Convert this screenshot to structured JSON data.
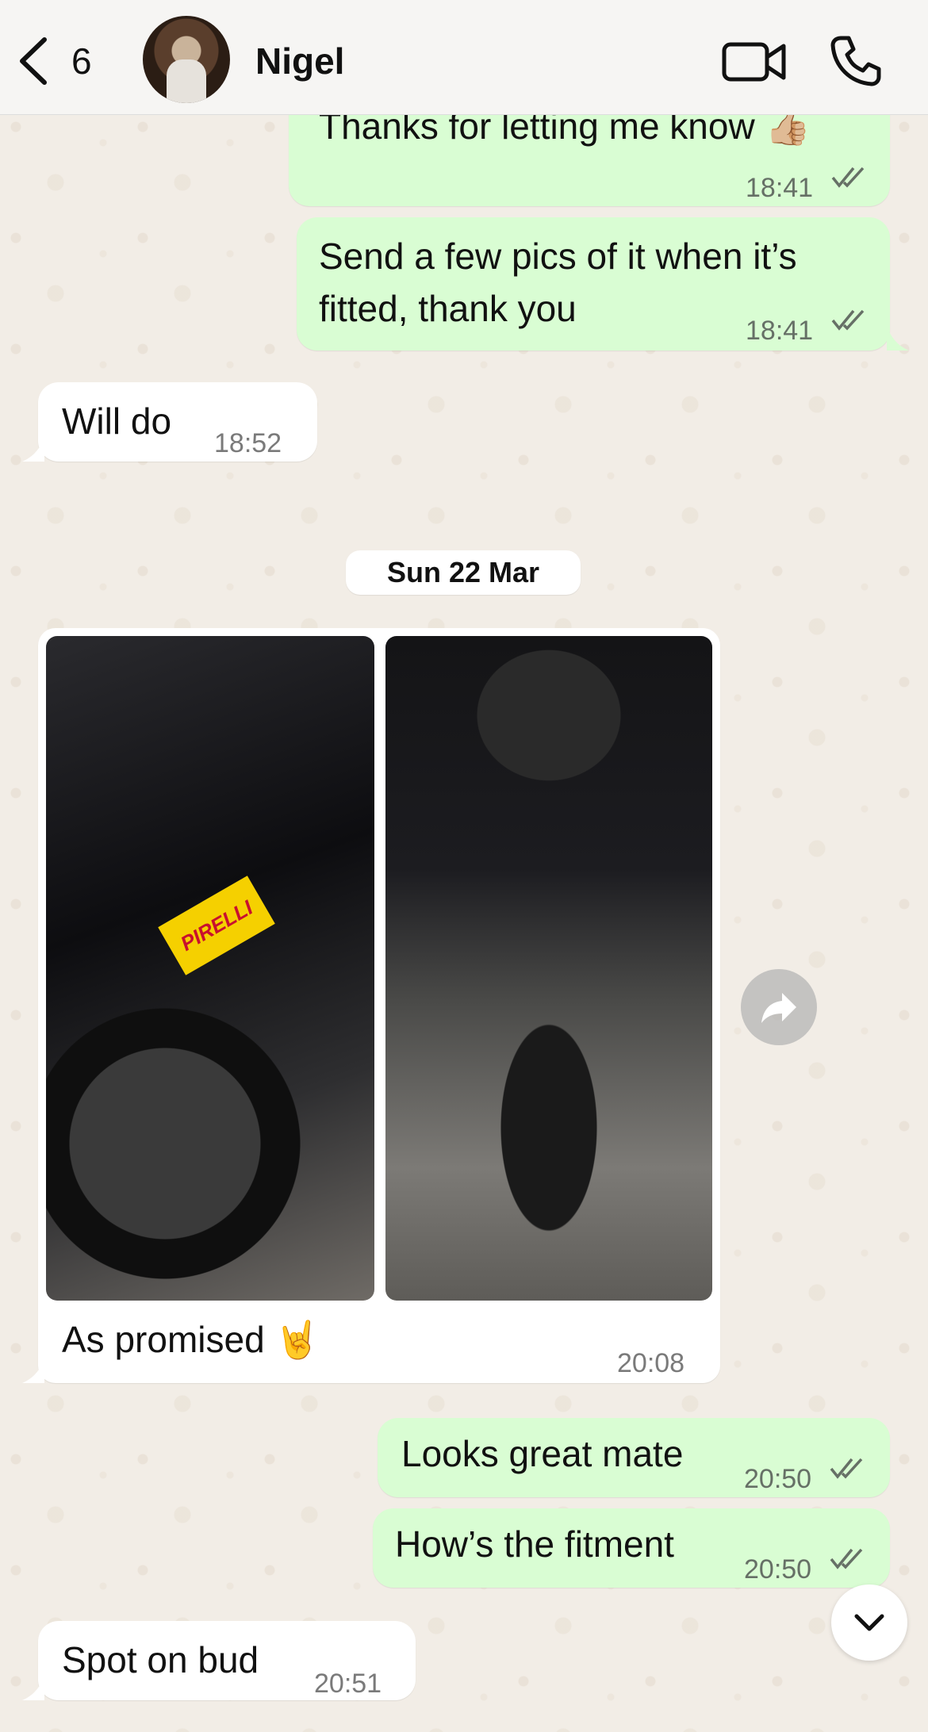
{
  "header": {
    "back_count": "6",
    "contact_name": "Nigel"
  },
  "messages": [
    {
      "text": "Thanks for letting me know 👍🏼",
      "time": "18:41",
      "direction": "out"
    },
    {
      "text_line1": "Send a few pics of it when it’s",
      "text_line2": "fitted, thank you",
      "time": "18:41",
      "direction": "out"
    },
    {
      "text": "Will do",
      "time": "18:52",
      "direction": "in"
    },
    {
      "caption": "As promised 🤘",
      "time": "20:08",
      "direction": "in"
    },
    {
      "text": "Looks great mate",
      "time": "20:50",
      "direction": "out"
    },
    {
      "text": "How’s the fitment",
      "time": "20:50",
      "direction": "out"
    },
    {
      "text": "Spot on bud",
      "time": "20:51",
      "direction": "in"
    }
  ],
  "date_separator": "Sun 22 Mar",
  "photo_text": {
    "brand": "PIRELLI"
  },
  "icons": {
    "back": "chevron-left-icon",
    "video": "video-camera-icon",
    "phone": "phone-icon",
    "forward": "forward-icon",
    "scroll_down": "chevron-down-icon"
  },
  "colors": {
    "outgoing_bubble": "#d9fdd3",
    "incoming_bubble": "#ffffff",
    "read_ticks": "#667066"
  }
}
